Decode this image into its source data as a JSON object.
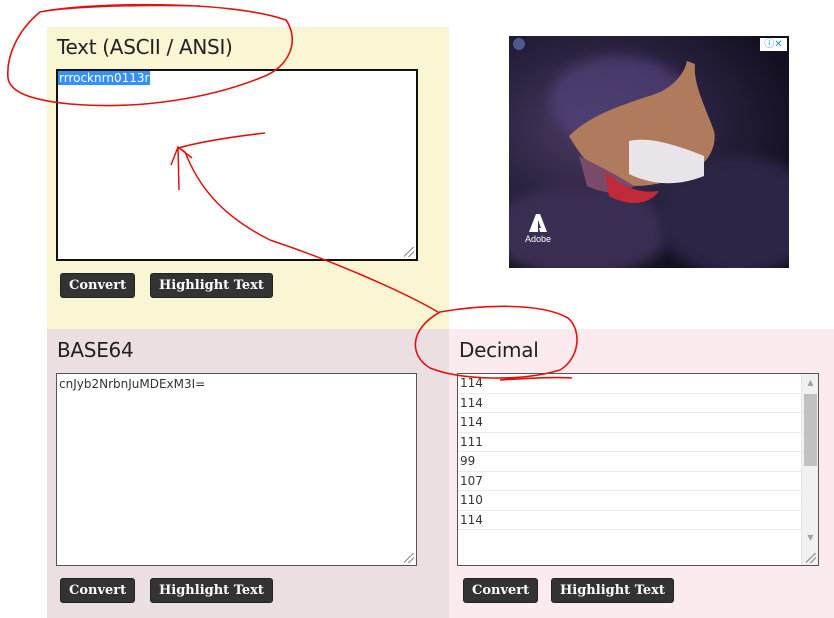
{
  "text_panel": {
    "heading": "Text (ASCII / ANSI)",
    "value": "rrrocknrn0113r",
    "convert_label": "Convert",
    "highlight_label": "Highlight Text"
  },
  "base64_panel": {
    "heading": "BASE64",
    "value": "cnJyb2NrbnJuMDExM3I=",
    "convert_label": "Convert",
    "highlight_label": "Highlight Text"
  },
  "decimal_panel": {
    "heading": "Decimal",
    "values": [
      "114",
      "114",
      "114",
      "111",
      "99",
      "107",
      "110",
      "114"
    ],
    "convert_label": "Convert",
    "highlight_label": "Highlight Text"
  },
  "ad": {
    "brand": "Adobe",
    "badge": "ⓘ✕"
  },
  "colors": {
    "text_panel_bg": "#faf5d2",
    "base64_panel_bg": "#ecdfe1",
    "decimal_panel_bg": "#fcebee",
    "button_bg": "#333333",
    "selection": "#3390ff",
    "annotation": "#e0120e"
  }
}
